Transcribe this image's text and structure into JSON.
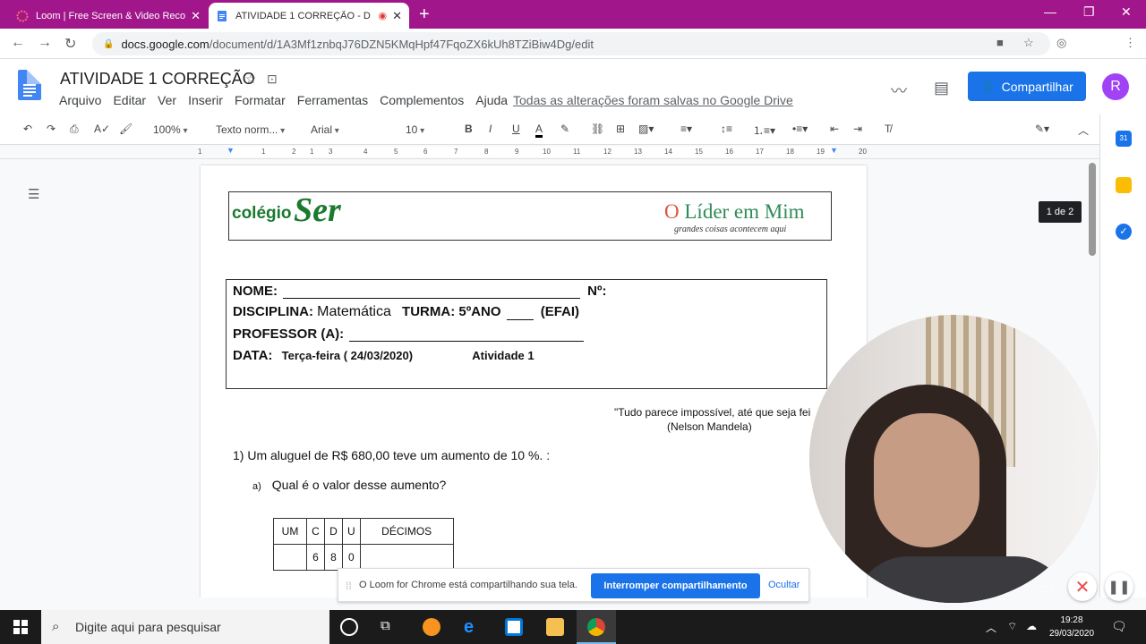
{
  "browser": {
    "tabs": [
      {
        "label": "Loom | Free Screen & Video Reco",
        "active": false
      },
      {
        "label": "ATIVIDADE 1 CORREÇÃO - D",
        "active": true
      }
    ],
    "url_host": "docs.google.com",
    "url_path": "/document/d/1A3Mf1znbqJ76DZN5KMqHpf47FqoZX6kUh8TZiBiw4Dg/edit",
    "profile_initial": "R"
  },
  "docs": {
    "title": "ATIVIDADE 1 CORREÇÃO",
    "menu": [
      "Arquivo",
      "Editar",
      "Ver",
      "Inserir",
      "Formatar",
      "Ferramentas",
      "Complementos",
      "Ajuda"
    ],
    "save_status": "Todas as alterações foram salvas no Google Drive",
    "share_label": "Compartilhar",
    "avatar_initial": "R",
    "toolbar": {
      "zoom": "100%",
      "style": "Texto norm...",
      "font": "Arial",
      "size": "10"
    },
    "ruler_ticks": [
      "1",
      "1",
      "2",
      "1",
      "3",
      "4",
      "5",
      "6",
      "7",
      "8",
      "9",
      "10",
      "11",
      "12",
      "13",
      "14",
      "15",
      "16",
      "17",
      "18",
      "19",
      "20"
    ],
    "page_badge": "1 de 2"
  },
  "document": {
    "logo_left_a": "colégio",
    "logo_left_b": "Ser",
    "logo_right_o": "O",
    "logo_right": "Líder em Mim",
    "logo_right_tag": "grandes coisas acontecem aqui",
    "nome_label": "NOME:",
    "numero_label": "Nº:",
    "disciplina_label": "DISCIPLINA:",
    "disciplina_value": "Matemática",
    "turma_label": "TURMA: 5ºANO",
    "turma_suffix": "(EFAI)",
    "professor_label": "PROFESSOR (A):",
    "data_label": "DATA:",
    "data_value": "Terça-feira ( 24/03/2020)",
    "atividade": "Atividade 1",
    "quote_line1": "\"Tudo parece impossível, até que seja fei",
    "quote_line2": "(Nelson Mandela)",
    "question1": "1)  Um aluguel de R$ 680,00 teve um aumento de 10 %. :",
    "question1a_marker": "a)",
    "question1a": "Qual é o valor desse aumento?",
    "table_headers": [
      "UM",
      "C",
      "D",
      "U",
      "DÉCIMOS"
    ],
    "table_row": [
      "",
      "6",
      "8",
      "0",
      ""
    ]
  },
  "loom": {
    "message": "O Loom for Chrome está compartilhando sua tela.",
    "stop_label": "Interromper compartilhamento",
    "hide_label": "Ocultar"
  },
  "taskbar": {
    "search_placeholder": "Digite aqui para pesquisar",
    "time": "19:28",
    "date": "29/03/2020"
  }
}
